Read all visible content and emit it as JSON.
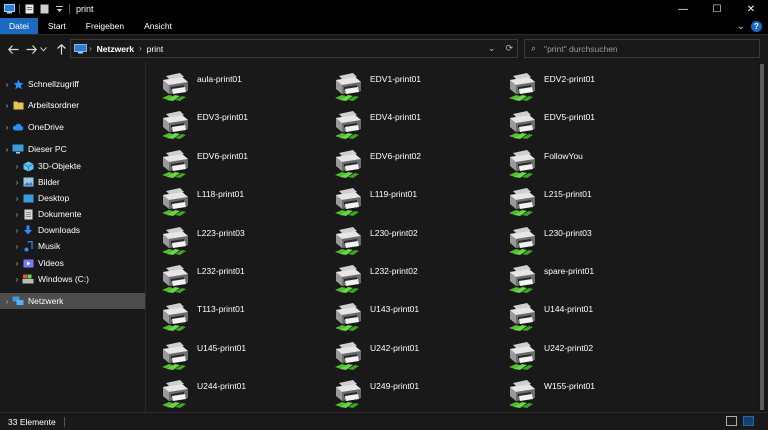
{
  "window": {
    "title": "print",
    "controls": {
      "minimize": "—",
      "maximize": "☐",
      "close": "✕"
    }
  },
  "ribbon": {
    "tabs": [
      "Datei",
      "Start",
      "Freigeben",
      "Ansicht"
    ],
    "expand": "⌄",
    "help": "?"
  },
  "address_bar": {
    "crumbs": [
      "Netzwerk",
      "print"
    ],
    "search_placeholder": "\"print\" durchsuchen"
  },
  "sidebar": {
    "items": [
      {
        "label": "Schnellzugriff",
        "icon": "star-icon",
        "color": "#2f8cff"
      },
      {
        "label": "Arbeitsordner",
        "icon": "folder-icon",
        "color": "#e8c15a"
      },
      {
        "label": "OneDrive",
        "icon": "cloud-icon",
        "color": "#2f8cff"
      },
      {
        "label": "Dieser PC",
        "icon": "pc-icon",
        "color": "#3a9be0"
      },
      {
        "label": "3D-Objekte",
        "icon": "cube-icon",
        "color": "#5fc3f0"
      },
      {
        "label": "Bilder",
        "icon": "pictures-icon",
        "color": "#9bc8e8"
      },
      {
        "label": "Desktop",
        "icon": "desktop-icon",
        "color": "#3a9be0"
      },
      {
        "label": "Dokumente",
        "icon": "documents-icon",
        "color": "#d8d8d8"
      },
      {
        "label": "Downloads",
        "icon": "download-icon",
        "color": "#2f8cff"
      },
      {
        "label": "Musik",
        "icon": "music-icon",
        "color": "#2f8cff"
      },
      {
        "label": "Videos",
        "icon": "video-icon",
        "color": "#7a7aff"
      },
      {
        "label": "Windows (C:)",
        "icon": "drive-icon",
        "color": "#bbbbbb"
      },
      {
        "label": "Netzwerk",
        "icon": "network-icon",
        "color": "#3a9be0"
      }
    ],
    "selected": "Netzwerk"
  },
  "printers": [
    "aula-print01",
    "EDV1-print01",
    "EDV2-print01",
    "EDV3-print01",
    "EDV4-print01",
    "EDV5-print01",
    "EDV6-print01",
    "EDV6-print02",
    "FollowYou",
    "L118-print01",
    "L119-print01",
    "L215-print01",
    "L223-print03",
    "L230-print02",
    "L230-print03",
    "L232-print01",
    "L232-print02",
    "spare-print01",
    "T113-print01",
    "U143-print01",
    "U144-print01",
    "U145-print01",
    "U242-print01",
    "U242-print02",
    "U244-print01",
    "U249-print01",
    "W155-print01"
  ],
  "status": {
    "count": "33 Elemente"
  },
  "colors": {
    "accent": "#1b6ac0",
    "background": "#191919",
    "selected": "#4d4d4d",
    "cable": "#6bd44a"
  }
}
